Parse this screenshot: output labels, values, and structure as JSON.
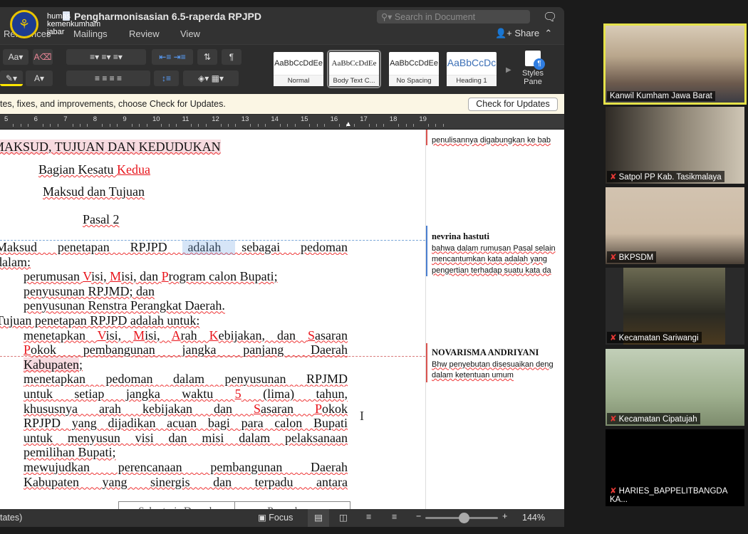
{
  "watermark": {
    "line1": "humas",
    "line2": "kemenkumham",
    "line3": "jabar"
  },
  "window": {
    "title": "Pengharmonisasian 6.5-raperda RPJPD",
    "search_placeholder": "Search in Document",
    "share_label": "Share"
  },
  "tabs": [
    "References",
    "Mailings",
    "Review",
    "View"
  ],
  "ribbon": {
    "styles": [
      {
        "sample": "AaBbCcDdEe",
        "name": "Normal"
      },
      {
        "sample": "AaBbCcDdEe",
        "name": "Body Text C..."
      },
      {
        "sample": "AaBbCcDdEe",
        "name": "No Spacing"
      },
      {
        "sample": "AaBbCcDc",
        "name": "Heading 1"
      }
    ],
    "styles_pane": "Styles Pane",
    "selected_style": "Body Text C..."
  },
  "update_bar": {
    "message": "tes, fixes, and improvements, choose Check for Updates.",
    "button": "Check for Updates"
  },
  "ruler": [
    "5",
    "6",
    "7",
    "8",
    "9",
    "10",
    "11",
    "12",
    "13",
    "14",
    "15",
    "16",
    "17",
    "18",
    "19"
  ],
  "document": {
    "headings": [
      [
        [
          "MAKSUD, TUJUAN DAN KEDUDUKAN",
          "del delbg"
        ]
      ],
      [
        [
          "Bagian ",
          ""
        ],
        [
          "Kesatu ",
          "del"
        ],
        [
          "Kedua",
          "ins"
        ]
      ],
      [
        [
          "Maksud dan Tujuan",
          ""
        ]
      ],
      [
        [
          "Pasal 2",
          ""
        ]
      ]
    ],
    "lines": [
      {
        "kind": "para",
        "j": true,
        "segs": [
          [
            "Maksud penetapan RPJPD ",
            ""
          ],
          [
            "adalah ",
            "del"
          ],
          [
            "sebagai pedoman",
            ""
          ]
        ]
      },
      {
        "kind": "para",
        "segs": [
          [
            "dalam:",
            ""
          ]
        ]
      },
      {
        "kind": "item",
        "num": "a.",
        "segs": [
          [
            "perumusan ",
            ""
          ],
          [
            "V",
            "ins"
          ],
          [
            "isi, ",
            ""
          ],
          [
            "M",
            "ins"
          ],
          [
            "isi, dan ",
            ""
          ],
          [
            "P",
            "ins"
          ],
          [
            "rogram calon Bupati;",
            ""
          ]
        ]
      },
      {
        "kind": "item",
        "num": "b.",
        "segs": [
          [
            "penyusunan RPJMD; dan",
            ""
          ]
        ]
      },
      {
        "kind": "item",
        "num": "c.",
        "segs": [
          [
            "penyusunan Renstra Perangkat Daerah.",
            ""
          ]
        ]
      },
      {
        "kind": "para",
        "segs": [
          [
            "Tujuan penetapan RPJPD ",
            ""
          ],
          [
            "adalah",
            "del"
          ],
          [
            " untuk:",
            ""
          ]
        ]
      },
      {
        "kind": "item",
        "num": "a.",
        "j": true,
        "segs": [
          [
            "menetapkan ",
            ""
          ],
          [
            "V",
            "ins"
          ],
          [
            "isi, ",
            ""
          ],
          [
            "M",
            "ins"
          ],
          [
            "isi, ",
            ""
          ],
          [
            "A",
            "ins"
          ],
          [
            "rah ",
            ""
          ],
          [
            "K",
            "ins"
          ],
          [
            "ebijakan, dan ",
            ""
          ],
          [
            "S",
            "ins"
          ],
          [
            "asaran",
            ""
          ]
        ]
      },
      {
        "kind": "cont",
        "j": true,
        "segs": [
          [
            "P",
            "ins"
          ],
          [
            "okok pembangunan jangka panjang Daerah",
            ""
          ]
        ]
      },
      {
        "kind": "cont",
        "segs": [
          [
            "Kabupaten",
            "del delbg"
          ],
          [
            ";",
            ""
          ]
        ]
      },
      {
        "kind": "item",
        "num": "b.",
        "j": true,
        "segs": [
          [
            "menetapkan pedoman dalam penyusunan RPJMD",
            ""
          ]
        ]
      },
      {
        "kind": "cont",
        "j": true,
        "segs": [
          [
            "untuk setiap jangka waktu ",
            ""
          ],
          [
            "5",
            "ins"
          ],
          [
            " (lima) tahun,",
            ""
          ]
        ]
      },
      {
        "kind": "cont",
        "j": true,
        "segs": [
          [
            "khususnya arah kebijakan dan ",
            ""
          ],
          [
            "S",
            "ins"
          ],
          [
            "asaran ",
            ""
          ],
          [
            "P",
            "ins"
          ],
          [
            "okok",
            ""
          ]
        ]
      },
      {
        "kind": "cont",
        "j": true,
        "segs": [
          [
            "RPJPD yang dijadikan acuan bagi para calon Bupati",
            ""
          ]
        ]
      },
      {
        "kind": "cont",
        "j": true,
        "segs": [
          [
            "untuk menyusun visi dan misi dalam pelaksanaan",
            ""
          ]
        ]
      },
      {
        "kind": "cont",
        "segs": [
          [
            "pemilihan Bupati;",
            ""
          ]
        ]
      },
      {
        "kind": "item",
        "num": "c.",
        "j": true,
        "segs": [
          [
            "mewujudkan perencanaan pembangunan Daerah",
            ""
          ]
        ]
      },
      {
        "kind": "cont",
        "j": true,
        "segs": [
          [
            "Kabupaten ",
            "del"
          ],
          [
            "yang sinergis dan terpadu antara",
            ""
          ]
        ]
      }
    ],
    "table": [
      "Sekretaris Daerah",
      "Pemrakarsa"
    ]
  },
  "comments": [
    {
      "author": "",
      "lines": [
        "penulisannya digabungkan ke bab"
      ],
      "color": "#d9534f"
    },
    {
      "author": "nevrina hastuti",
      "lines": [
        "bahwa dalam rumusan Pasal selain",
        "mencantumkan kata adalah yang",
        "pengertian terhadap suatu kata da"
      ],
      "color": "#4a7fd0"
    },
    {
      "author": "NOVARISMA ANDRIYANI",
      "lines": [
        "Bhw penyebutan disesuaikan deng",
        "dalam ketentuan umum"
      ],
      "color": "#d9534f"
    }
  ],
  "status": {
    "left": "tates)",
    "focus": "Focus",
    "zoom": "144%",
    "zoom_level_percent": 144
  },
  "participants": [
    {
      "name": "Kanwil Kumham Jawa Barat",
      "muted": false,
      "active": true
    },
    {
      "name": "Satpol PP Kab. Tasikmalaya",
      "muted": true
    },
    {
      "name": "BKPSDM",
      "muted": true
    },
    {
      "name": "Kecamatan Sariwangi",
      "muted": true
    },
    {
      "name": "Kecamatan Cipatujah",
      "muted": true
    },
    {
      "name": "HARIES_BAPPELITBANGDA KA...",
      "muted": true
    }
  ]
}
